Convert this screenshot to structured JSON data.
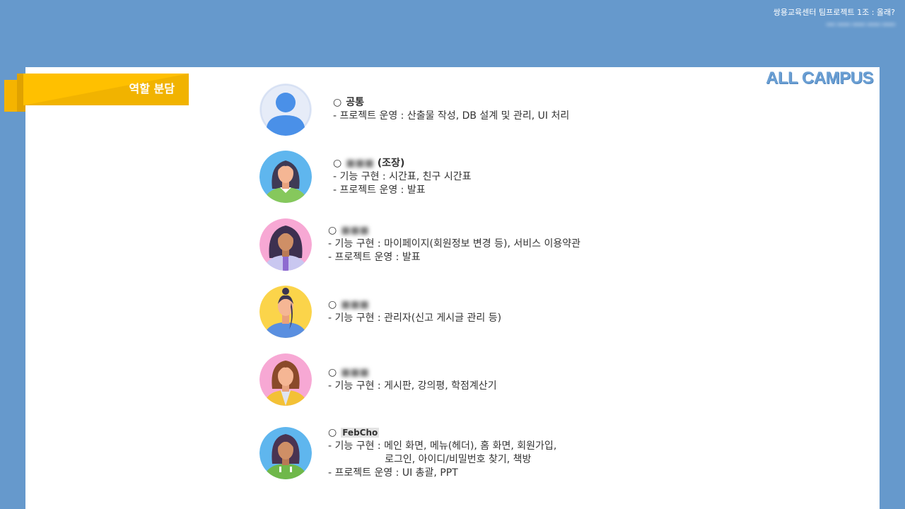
{
  "header": {
    "title": "쌍용교육센터  팀프로젝트  1조 : 올래?",
    "members": "━━ ━━━ ━━━ ━━━ ━━━"
  },
  "ribbon": {
    "label": "역할 분담"
  },
  "logo": "ALL CAMPUS",
  "bullet": "○",
  "roles": [
    {
      "avatar": "default-user-icon",
      "name": "공통",
      "suffix": "",
      "lines": [
        "- 프로젝트 운영 : 산출물 작성, DB 설계 및 관리, UI 처리"
      ]
    },
    {
      "avatar": "female-avatar-blue",
      "name": "■■■",
      "suffix": " (조장)",
      "lines": [
        "- 기능 구현 : 시간표, 친구 시간표",
        "- 프로젝트 운영 : 발표"
      ]
    },
    {
      "avatar": "female-avatar-pink",
      "name": "■■■",
      "suffix": "",
      "lines": [
        "- 기능 구현 : 마이페이지(회원정보 변경 등), 서비스 이용약관",
        "- 프로젝트 운영 : 발표"
      ]
    },
    {
      "avatar": "female-avatar-yellow",
      "name": "■■■",
      "suffix": "",
      "lines": [
        "- 기능 구현 : 관리자(신고 게시글 관리 등)"
      ]
    },
    {
      "avatar": "female-avatar-pink-2",
      "name": "■■■",
      "suffix": "",
      "lines": [
        "- 기능 구현 : 게시판, 강의평, 학점계산기"
      ]
    },
    {
      "avatar": "female-avatar-green",
      "name": "FebCho",
      "suffix": "",
      "lines": [
        "- 기능 구현 : 메인 화면, 메뉴(헤더), 홈 화면, 회원가입,",
        "                  로그인, 아이디/비밀번호 찾기, 책방",
        "- 프로젝트 운영 : UI 총괄, PPT"
      ]
    }
  ]
}
